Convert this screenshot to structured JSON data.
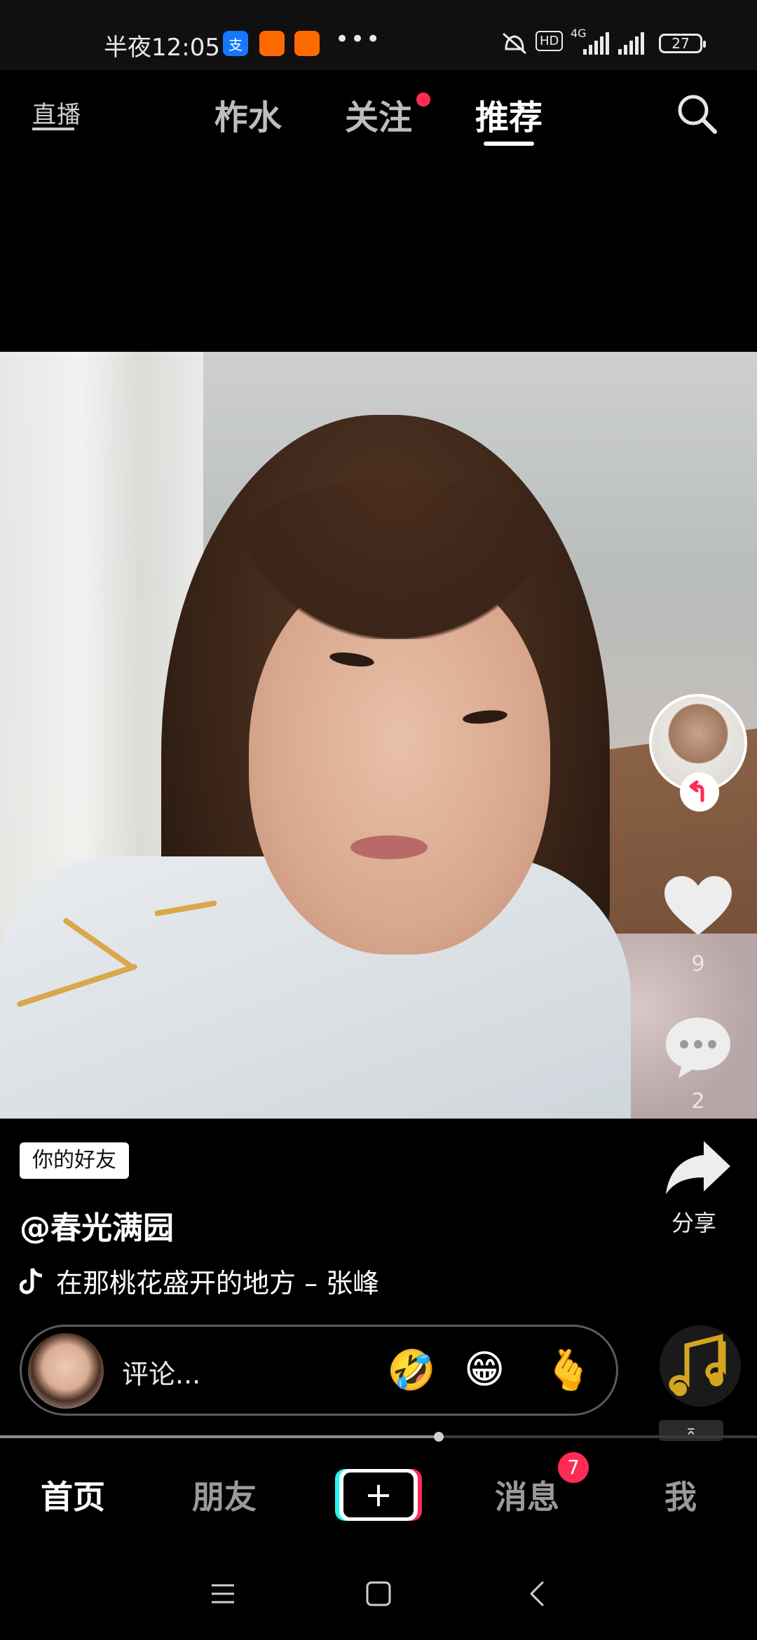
{
  "status_bar": {
    "time": "半夜12:05",
    "app_icons": [
      {
        "name": "alipay-icon",
        "glyph": "支",
        "color": "#1677ff"
      },
      {
        "name": "taobao-icon",
        "glyph": "◦",
        "color": "#ff6a00"
      },
      {
        "name": "taobao-icon",
        "glyph": "◦",
        "color": "#ff6a00"
      }
    ],
    "more": "•••",
    "network": "4G",
    "hd": "HD",
    "battery": "27"
  },
  "top_nav": {
    "live_label": "直播",
    "tabs": [
      {
        "label": "柞水",
        "active": false
      },
      {
        "label": "关注",
        "active": false,
        "dot": true
      },
      {
        "label": "推荐",
        "active": true
      }
    ]
  },
  "video": {
    "right_rail": {
      "like_count": "9",
      "comment_count": "2",
      "share_label": "分享"
    },
    "friend_badge": "你的好友",
    "username": "@春光满园",
    "music": "在那桃花盛开的地方 – 张峰"
  },
  "comment_bar": {
    "placeholder": "评论...",
    "emojis": [
      "🤣",
      "😁",
      "🫰"
    ]
  },
  "progress": {
    "fraction": 0.58
  },
  "bottom_nav": {
    "items": [
      {
        "label": "首页",
        "active": true
      },
      {
        "label": "朋友",
        "active": false
      },
      {
        "label": "消息",
        "active": false,
        "badge": "7"
      },
      {
        "label": "我",
        "active": false
      }
    ],
    "plus": "+"
  },
  "colors": {
    "accent_red": "#fe2c55",
    "accent_cyan": "#25f4ee"
  }
}
